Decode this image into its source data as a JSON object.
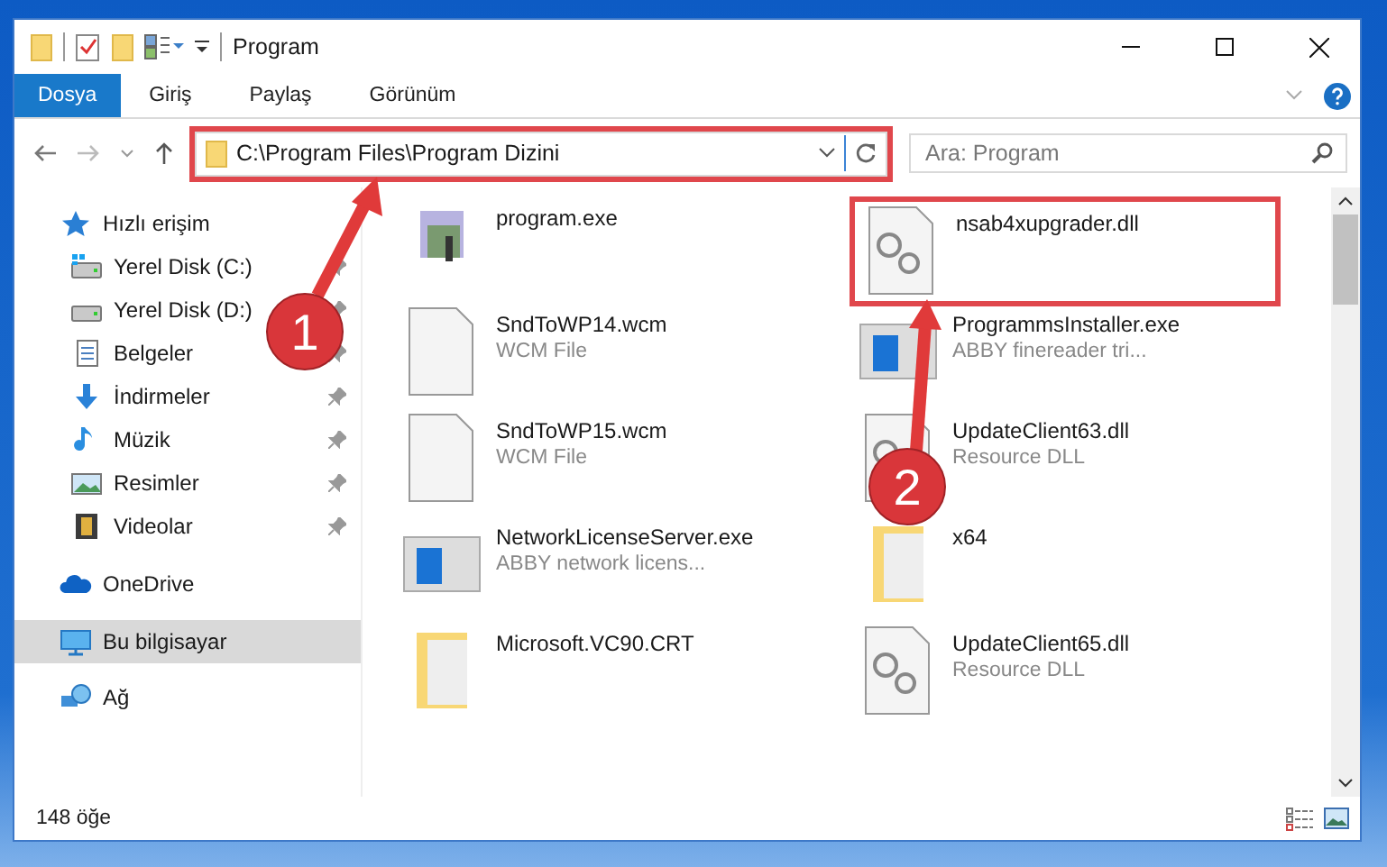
{
  "window": {
    "title": "Program"
  },
  "ribbon_tabs": [
    {
      "label": "Dosya",
      "selected": true
    },
    {
      "label": "Giriş",
      "selected": false
    },
    {
      "label": "Paylaş",
      "selected": false
    },
    {
      "label": "Görünüm",
      "selected": false
    }
  ],
  "address": {
    "path": "C:\\Program Files\\Program Dizini",
    "highlighted": true
  },
  "search": {
    "placeholder": "Ara: Program"
  },
  "sidebar": {
    "items": [
      {
        "label": "Hızlı erişim",
        "kind": "star",
        "selected": false,
        "children": [
          {
            "label": "Yerel Disk (C:)",
            "kind": "drive-c",
            "pinned": true
          },
          {
            "label": "Yerel Disk (D:)",
            "kind": "drive",
            "pinned": true
          },
          {
            "label": "Belgeler",
            "kind": "doc",
            "pinned": true
          },
          {
            "label": "İndirmeler",
            "kind": "download",
            "pinned": true
          },
          {
            "label": "Müzik",
            "kind": "music",
            "pinned": true
          },
          {
            "label": "Resimler",
            "kind": "image",
            "pinned": true
          },
          {
            "label": "Videolar",
            "kind": "video",
            "pinned": true
          }
        ]
      },
      {
        "label": "OneDrive",
        "kind": "cloud",
        "selected": false
      },
      {
        "label": "Bu bilgisayar",
        "kind": "pc",
        "selected": true
      },
      {
        "label": "Ağ",
        "kind": "network",
        "selected": false
      }
    ]
  },
  "files": [
    {
      "name": "program.exe",
      "kind": "exe",
      "highlighted": false
    },
    {
      "name": "nsab4xupgrader.dll",
      "kind": "dll",
      "highlighted": true
    },
    {
      "name": "SndToWP14.wcm",
      "detail": "WCM File",
      "kind": "blank",
      "highlighted": false
    },
    {
      "name": "ProgrammsInstaller.exe",
      "detail": "ABBY finereader tri...",
      "kind": "app",
      "highlighted": false
    },
    {
      "name": "SndToWP15.wcm",
      "detail": "WCM File",
      "kind": "blank",
      "highlighted": false
    },
    {
      "name": "UpdateClient63.dll",
      "detail": "Resource DLL",
      "kind": "dll",
      "highlighted": false
    },
    {
      "name": "NetworkLicenseServer.exe",
      "detail": "ABBY network licens...",
      "kind": "app",
      "highlighted": false
    },
    {
      "name": "x64",
      "kind": "folder",
      "highlighted": false
    },
    {
      "name": "Microsoft.VC90.CRT",
      "kind": "folder",
      "highlighted": false
    },
    {
      "name": "UpdateClient65.dll",
      "detail": "Resource DLL",
      "kind": "dll",
      "highlighted": false
    }
  ],
  "status_bar": {
    "count": "148 öğe"
  },
  "annotations": [
    {
      "number": "1"
    },
    {
      "number": "2"
    }
  ]
}
